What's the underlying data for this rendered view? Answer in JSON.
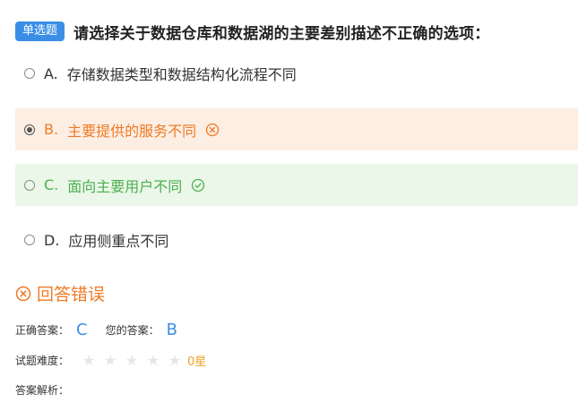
{
  "question": {
    "type_badge": "单选题",
    "title": "请选择关于数据仓库和数据湖的主要差别描述不正确的选项："
  },
  "options": [
    {
      "letter": "A.",
      "text": "存储数据类型和数据结构化流程不同",
      "selected": false,
      "status": "none"
    },
    {
      "letter": "B.",
      "text": "主要提供的服务不同",
      "selected": true,
      "status": "wrong"
    },
    {
      "letter": "C.",
      "text": "面向主要用户不同",
      "selected": false,
      "status": "correct"
    },
    {
      "letter": "D.",
      "text": "应用侧重点不同",
      "selected": false,
      "status": "none"
    }
  ],
  "result": {
    "text": "回答错误",
    "icon": "circle-x-icon"
  },
  "answers": {
    "correct_label": "正确答案：",
    "correct_value": "C",
    "yours_label": "您的答案：",
    "yours_value": "B"
  },
  "difficulty": {
    "label": "试题难度：",
    "stars_total": 5,
    "stars_filled": 0,
    "rating_text": "0星"
  },
  "analysis": {
    "label": "答案解析："
  },
  "colors": {
    "accent_blue": "#3a8ee6",
    "wrong_orange": "#ef7a24",
    "wrong_bg": "#fdeee4",
    "correct_green": "#4caf50",
    "correct_bg": "#ebf7e9",
    "star_empty": "#e6e6e6",
    "rating_gold": "#f0a020"
  }
}
